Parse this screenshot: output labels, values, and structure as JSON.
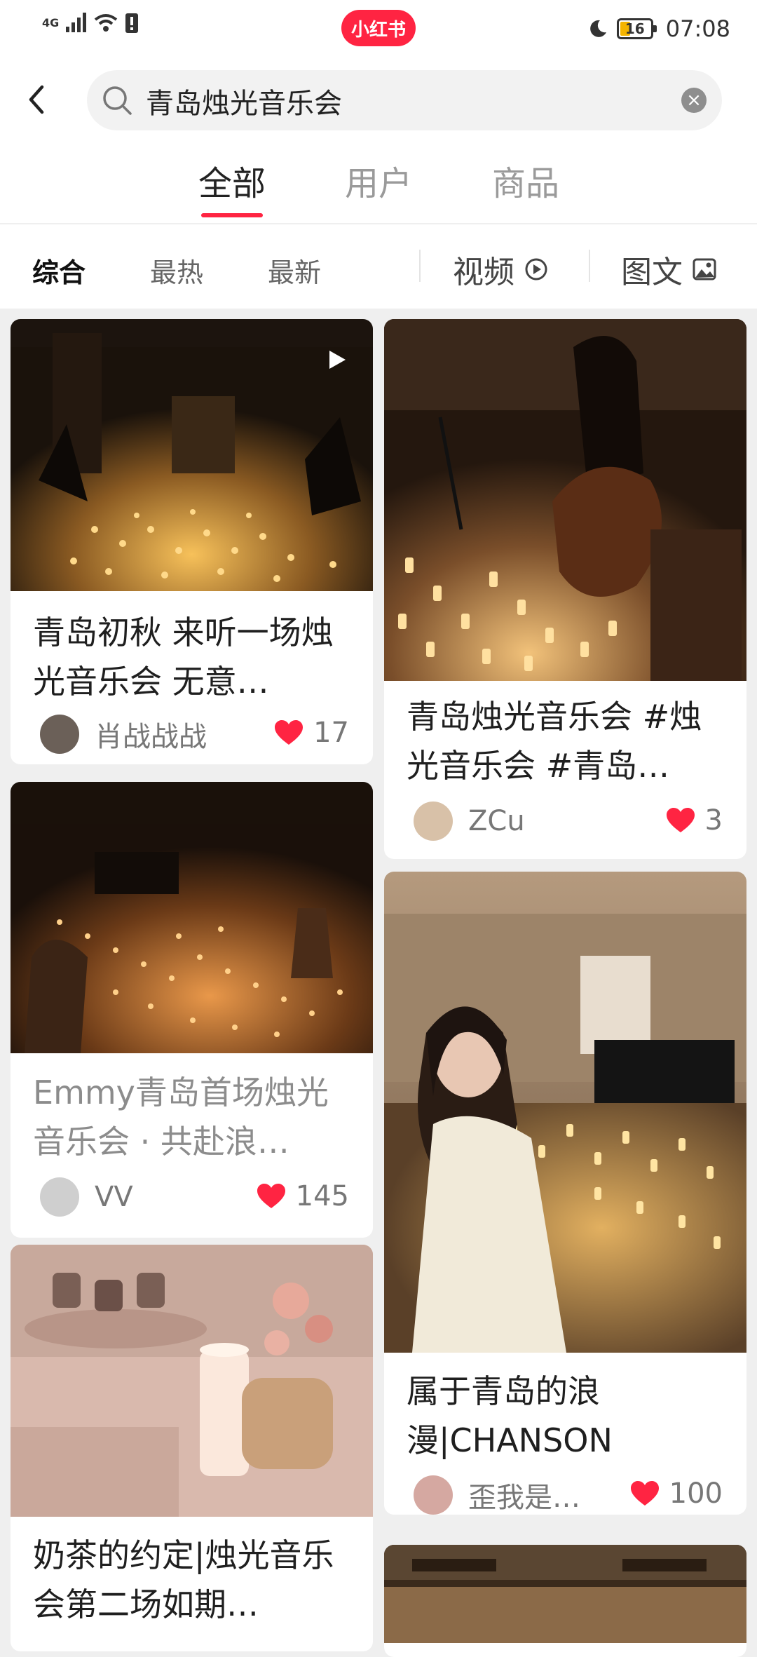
{
  "status_bar": {
    "network": "4G",
    "brand": "小红书",
    "battery": "16",
    "time": "07:08"
  },
  "search": {
    "query": "青岛烛光音乐会",
    "placeholder": ""
  },
  "tabs": [
    {
      "label": "全部",
      "active": true
    },
    {
      "label": "用户",
      "active": false
    },
    {
      "label": "商品",
      "active": false
    }
  ],
  "filters": {
    "sort": [
      {
        "label": "综合",
        "active": true
      },
      {
        "label": "最热",
        "active": false
      },
      {
        "label": "最新",
        "active": false
      }
    ],
    "video_label": "视频",
    "image_text_label": "图文"
  },
  "cards": [
    {
      "title": "青岛初秋 来听一场烛光音乐会 无意…",
      "user": "肖战战战",
      "likes": "17",
      "is_video": true
    },
    {
      "title": "Emmy青岛首场烛光音乐会 · 共赴浪…",
      "user": "VV",
      "likes": "145",
      "is_video": false
    },
    {
      "title": "奶茶的约定|烛光音乐会第二场如期…",
      "user": "",
      "likes": "",
      "is_video": false
    },
    {
      "title": "青岛烛光音乐会 #烛光音乐会 #青岛…",
      "user": "ZCu",
      "likes": "3",
      "is_video": false
    },
    {
      "title": "属于青岛的浪漫|CHANSON EMMY…",
      "user": "歪我是…",
      "likes": "100",
      "is_video": false
    }
  ],
  "colors": {
    "brand_red": "#ff2442",
    "like_heart": "#ff2442",
    "background": "#efefef"
  }
}
